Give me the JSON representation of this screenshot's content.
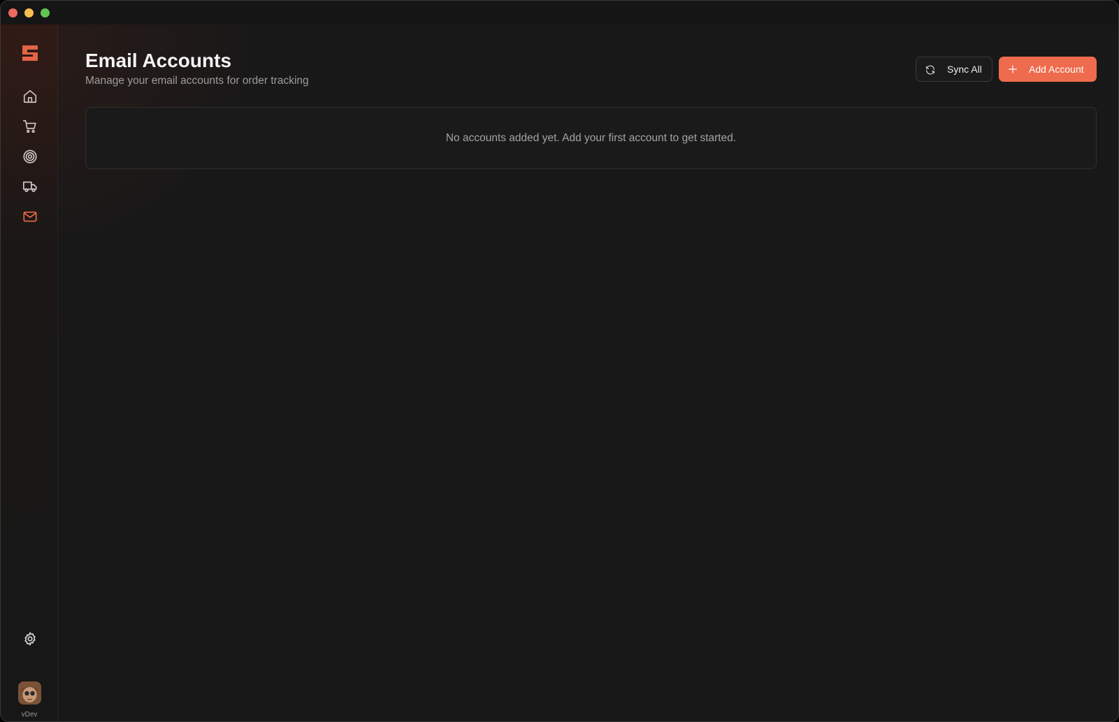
{
  "window": {
    "controls": [
      "close",
      "minimize",
      "maximize"
    ]
  },
  "sidebar": {
    "logo": "app-logo",
    "items": [
      {
        "icon": "home-icon",
        "active": false
      },
      {
        "icon": "cart-icon",
        "active": false
      },
      {
        "icon": "target-icon",
        "active": false
      },
      {
        "icon": "truck-icon",
        "active": false
      },
      {
        "icon": "mail-icon",
        "active": true
      }
    ],
    "settings_icon": "gear-icon",
    "user": {
      "name": "vDev"
    }
  },
  "header": {
    "title": "Email Accounts",
    "subtitle": "Manage your email accounts for order tracking",
    "sync_label": "Sync All",
    "add_label": "Add Account"
  },
  "main": {
    "empty_message": "No accounts added yet. Add your first account to get started."
  },
  "colors": {
    "accent": "#ee6b4d",
    "background": "#181818",
    "text_primary": "#f4f4f4",
    "text_muted": "#9d9d9d"
  }
}
